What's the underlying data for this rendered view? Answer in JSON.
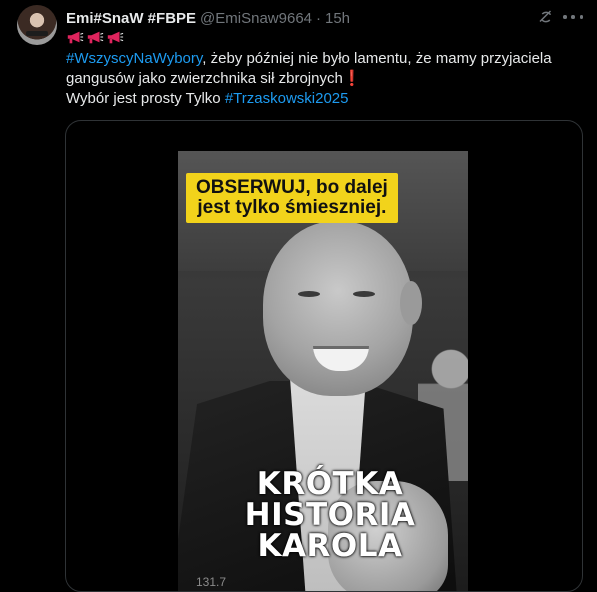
{
  "author": {
    "display_name": "Emi#SnaW #FBPE",
    "handle": "@EmiSnaw9664",
    "separator": "·",
    "time": "15h"
  },
  "icons": {
    "grok": "grok-icon",
    "more": "more-icon",
    "megaphone": "megaphone-icon"
  },
  "tweet": {
    "megaphone_count": 3,
    "line1_link": "#WszyscyNaWybory",
    "line1_rest": ", żeby później nie było lamentu, że mamy przyjaciela gangusów jako zwierzchnika sił zbrojnych",
    "line1_exclamation": "❗",
    "line2_text": "Wybór jest prosty Tylko ",
    "line2_link": "#Trzaskowski2025"
  },
  "media": {
    "caption_line1": "OBSERWUJ, bo dalej",
    "caption_line2": "jest tylko śmieszniej.",
    "title_line1": "KRÓTKA",
    "title_line2": "HISTORIA",
    "title_line3": "KAROLA",
    "background_number": "131.7"
  },
  "colors": {
    "background": "#000000",
    "text": "#e7e9ea",
    "muted": "#71767b",
    "link": "#1d9bf0",
    "caption_yellow": "#f2d31b"
  }
}
